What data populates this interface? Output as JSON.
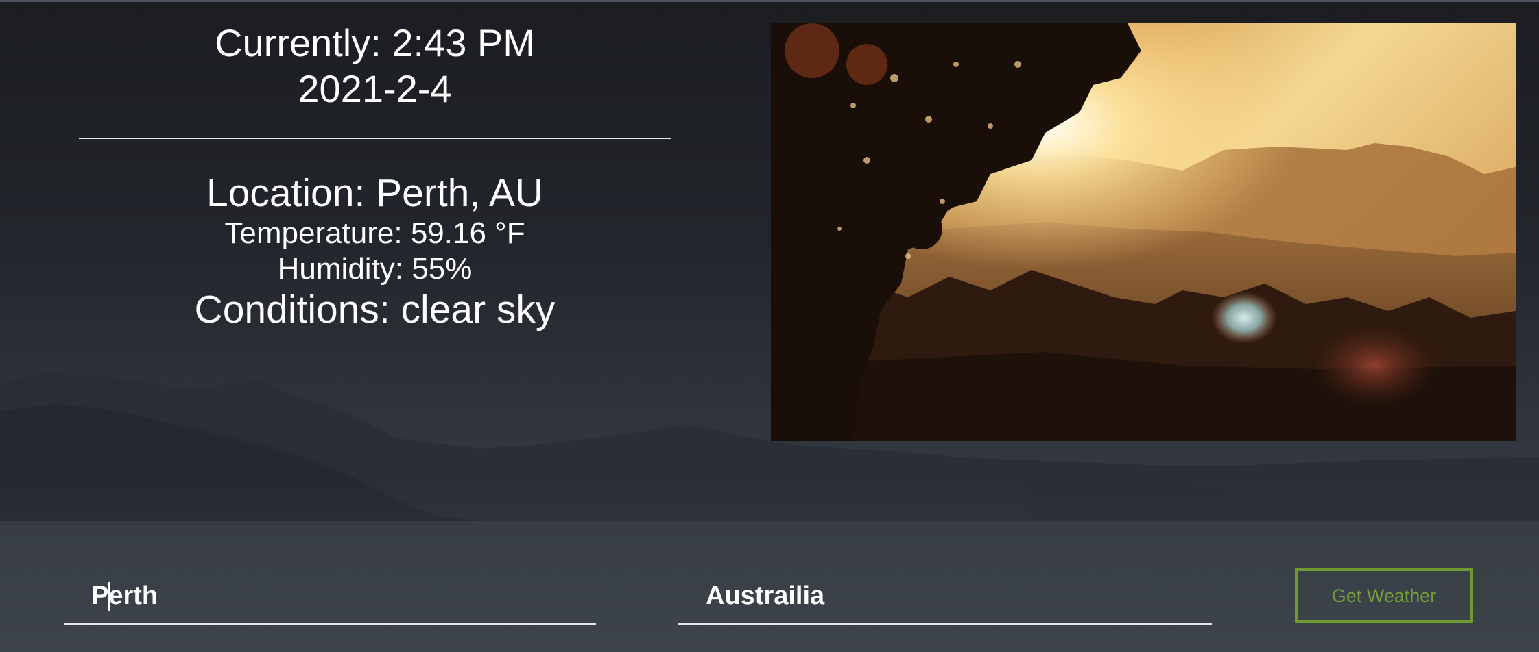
{
  "weather": {
    "time_line": "Currently: 2:43 PM",
    "date_line": "2021-2-4",
    "location_line": "Location: Perth, AU",
    "temperature_line": "Temperature: 59.16 °F",
    "humidity_line": "Humidity: 55%",
    "conditions_line": "Conditions: clear sky"
  },
  "form": {
    "city_value": "Perth",
    "country_value": "Austrailia",
    "submit_label": "Get Weather"
  },
  "colors": {
    "accent_button": "#6e9a2e",
    "text": "#ffffff",
    "divider": "#e6e6e6"
  }
}
